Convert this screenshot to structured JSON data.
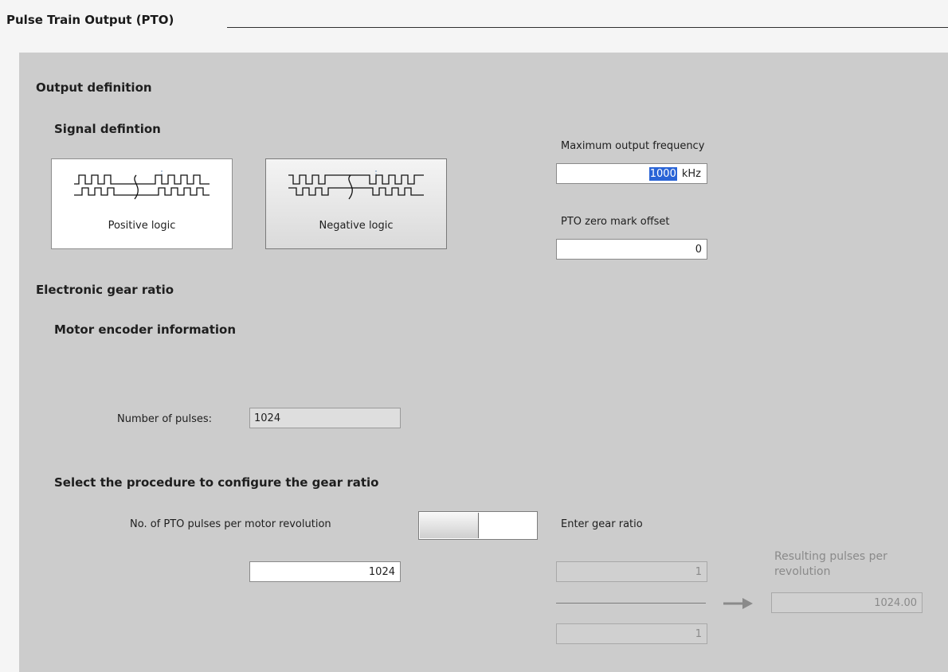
{
  "header": {
    "title": "Pulse Train Output (PTO)"
  },
  "output_definition": {
    "heading": "Output definition",
    "signal_heading": "Signal defintion",
    "positive_label": "Positive logic",
    "negative_label": "Negative logic",
    "selected_signal": "Negative logic",
    "max_freq_label": "Maximum output frequency",
    "max_freq_value": "1000",
    "max_freq_unit": "kHz",
    "zero_offset_label": "PTO zero mark offset",
    "zero_offset_value": "0"
  },
  "gear_ratio": {
    "heading": "Electronic gear ratio",
    "motor_heading": "Motor encoder information",
    "pulses_label": "Number of pulses:",
    "pulses_value": "1024",
    "procedure_heading": "Select the procedure to configure the gear ratio",
    "pto_pulses_label": "No. of PTO pulses per motor revolution",
    "enter_ratio_label": "Enter gear ratio",
    "pto_pulses_value": "1024",
    "numerator_value": "1",
    "denominator_value": "1",
    "resulting_label_line1": "Resulting pulses per",
    "resulting_label_line2": "revolution",
    "resulting_value": "1024.00"
  },
  "icons": {
    "positive_waveform": "positive-logic-waveform-icon",
    "negative_waveform": "negative-logic-waveform-icon",
    "arrow": "arrow-right-icon"
  },
  "colors": {
    "panel": "#cccccc",
    "selection": "#2a64d6"
  }
}
